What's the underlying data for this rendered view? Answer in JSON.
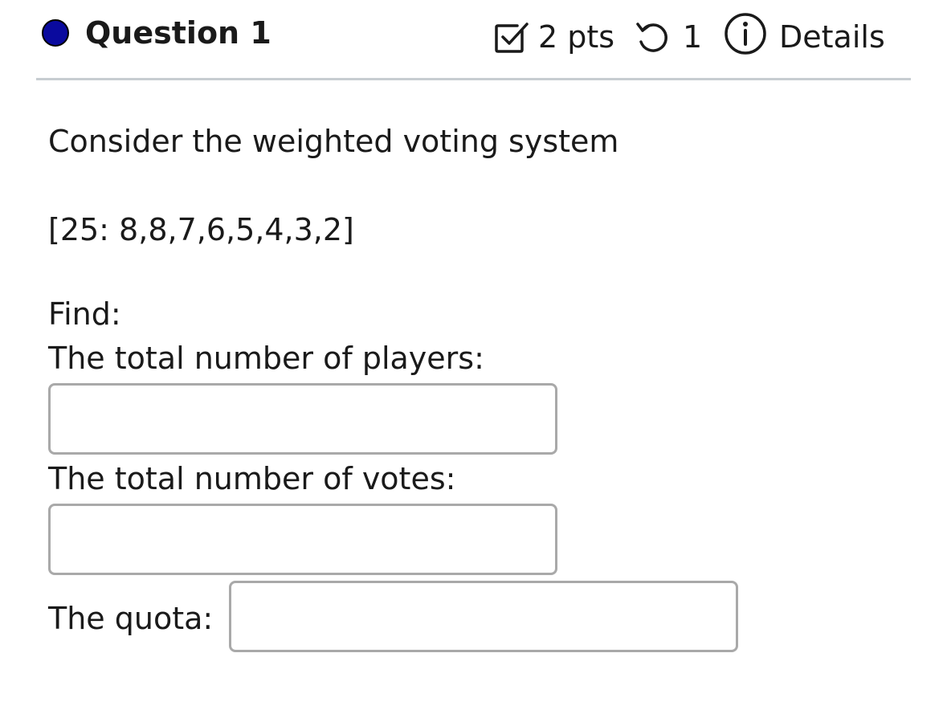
{
  "question": {
    "title": "Question 1",
    "points": "2 pts",
    "attempts": "1",
    "details_label": "Details",
    "status_color": "#0a0a9e",
    "icons": {
      "points": "checkbox-icon",
      "attempts": "retry-icon",
      "details": "info-icon"
    }
  },
  "prompt": {
    "intro": "Consider the weighted voting system",
    "system": "[25: 8,8,7,6,5,4,3,2]",
    "find": "Find:"
  },
  "fields": [
    {
      "label": "The total number of players:",
      "value": ""
    },
    {
      "label": "The total number of votes:",
      "value": ""
    },
    {
      "label": "The quota:",
      "value": ""
    }
  ]
}
